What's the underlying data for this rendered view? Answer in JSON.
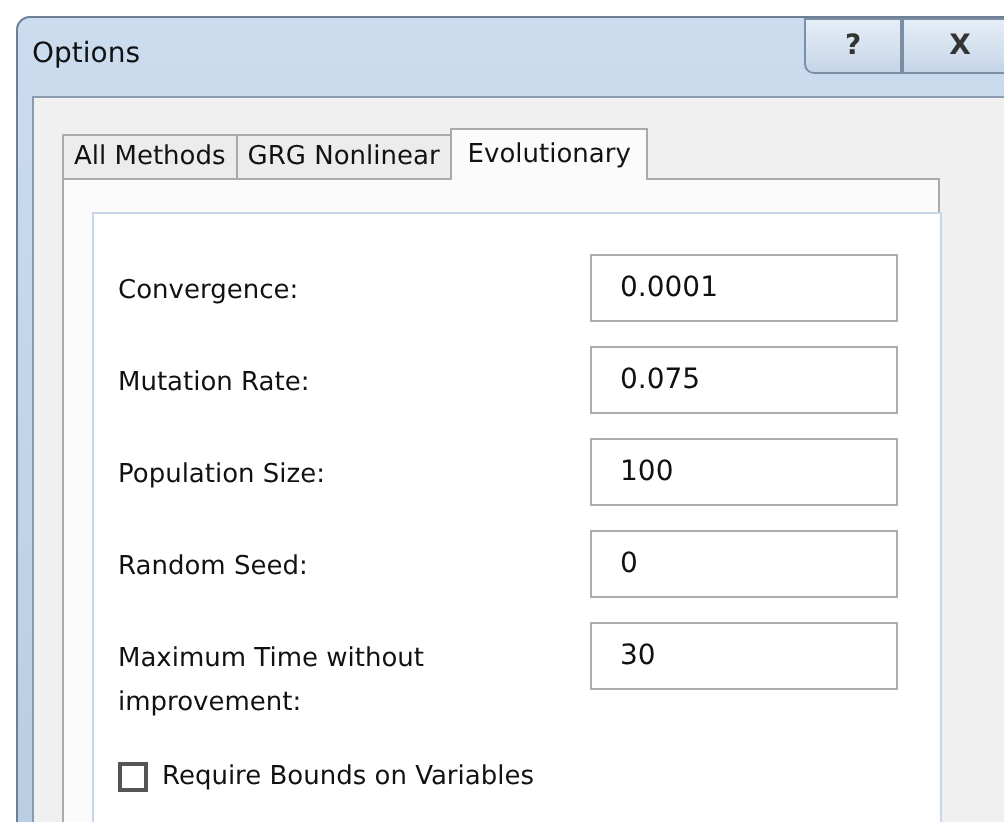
{
  "window": {
    "title": "Options"
  },
  "title_buttons": [
    {
      "kind": "help",
      "label": "?"
    },
    {
      "kind": "close",
      "label": "X"
    }
  ],
  "tabs": [
    {
      "label": "All Methods",
      "selected": false
    },
    {
      "label": "GRG Nonlinear",
      "selected": false
    },
    {
      "label": "Evolutionary",
      "selected": true
    }
  ],
  "fields": [
    {
      "label": "Convergence:",
      "value": "0.0001"
    },
    {
      "label": "Mutation Rate:",
      "value": "0.075"
    },
    {
      "label": "Population Size:",
      "value": "100"
    },
    {
      "label": "Random Seed:",
      "value": "0"
    },
    {
      "label": "Maximum Time without improvement:",
      "value": "30"
    }
  ],
  "checkboxes": [
    {
      "label": "Require Bounds on Variables",
      "checked": false
    }
  ]
}
